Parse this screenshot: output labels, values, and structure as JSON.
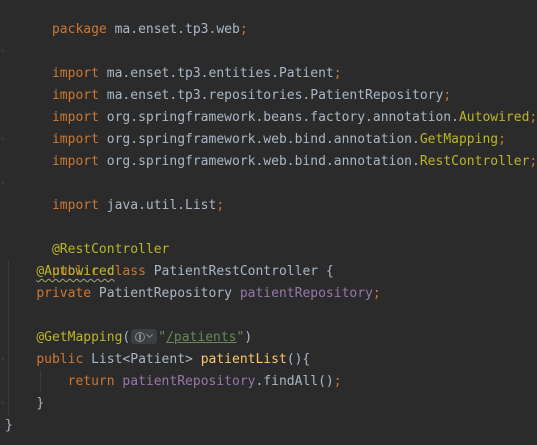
{
  "code": {
    "l1": {
      "kw": "package",
      "pkg": " ma.enset.tp3.web",
      "semi": ";"
    },
    "l3": {
      "kw": "import",
      "path": " ma.enset.tp3.entities.Patient",
      "semi": ";"
    },
    "l4": {
      "kw": "import",
      "path": " ma.enset.tp3.repositories.PatientRepository",
      "semi": ";"
    },
    "l5": {
      "kw": "import",
      "path": " org.springframework.beans.factory.annotation.",
      "cls": "Autowired",
      "semi": ";"
    },
    "l6": {
      "kw": "import",
      "path": " org.springframework.web.bind.annotation.",
      "cls": "GetMapping",
      "semi": ";"
    },
    "l7": {
      "kw": "import",
      "path": " org.springframework.web.bind.annotation.",
      "cls": "RestController",
      "semi": ";"
    },
    "l9": {
      "kw": "import",
      "path": " java.util.List",
      "semi": ";"
    },
    "l11": {
      "ann": "@RestController"
    },
    "l12": {
      "kw1": "public",
      "kw2": " class",
      "name": " PatientRestController {"
    },
    "l13": {
      "ann": "@Autowired"
    },
    "l14": {
      "kw": "private",
      "type": " PatientRepository ",
      "field": "patientRepository",
      "semi": ";"
    },
    "l16": {
      "ann": "@GetMapping",
      "open": "(",
      "q1": "\"",
      "str": "/patients",
      "q2": "\"",
      "close": ")"
    },
    "l17": {
      "kw": "public",
      "type": " List<Patient> ",
      "fn": "patientList",
      "rest": "(){"
    },
    "l18": {
      "kw": "return",
      "sp": " ",
      "field": "patientRepository",
      "rest": ".findAll()",
      "semi": ";"
    },
    "l19": {
      "brace": "}"
    },
    "l20": {
      "brace": "}"
    }
  },
  "theme": {
    "background": "#2b2b2b",
    "keyword": "#cc7832",
    "annotation": "#bbb529",
    "field": "#9876aa",
    "method": "#ffc66d",
    "string": "#6a8759",
    "text": "#a9b7c6"
  },
  "icons": {
    "inlay": "globe-icon",
    "fold": "fold-marker-icon"
  }
}
